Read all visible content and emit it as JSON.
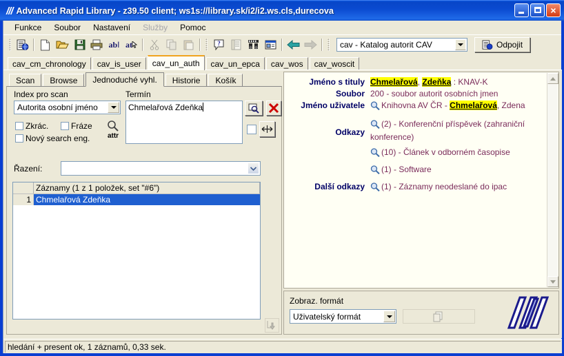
{
  "window": {
    "title": "Advanced Rapid Library - z39.50 client; ws1s://library.sk/i2/i2.ws.cls,durecova",
    "logo_mark": "///",
    "minimize_label": "Minimize",
    "maximize_label": "Maximize",
    "close_label": "×"
  },
  "menu": {
    "items": [
      {
        "label": "Funkce",
        "disabled": false
      },
      {
        "label": "Soubor",
        "disabled": false
      },
      {
        "label": "Nastavení",
        "disabled": false
      },
      {
        "label": "Služby",
        "disabled": true
      },
      {
        "label": "Pomoc",
        "disabled": false
      }
    ]
  },
  "toolbar": {
    "icons": [
      "connect-icon",
      "new-document-icon",
      "open-folder-icon",
      "save-icon",
      "print-icon",
      "abl-icon",
      "at-icon",
      "cut-icon",
      "copy-icon",
      "paste-icon",
      "help-icon",
      "list-icon",
      "find-binoculars-icon",
      "window-icon",
      "back-arrow-icon",
      "forward-arrow-icon"
    ],
    "database_combo": "cav - Katalog autorit CAV",
    "disconnect_label": "Odpojit",
    "disconnect_icon": "connect-icon"
  },
  "main_tabs": [
    {
      "label": "cav_cm_chronology",
      "active": false
    },
    {
      "label": "cav_is_user",
      "active": false
    },
    {
      "label": "cav_un_auth",
      "active": true
    },
    {
      "label": "cav_un_epca",
      "active": false
    },
    {
      "label": "cav_wos",
      "active": false
    },
    {
      "label": "cav_woscit",
      "active": false
    }
  ],
  "sub_tabs": [
    {
      "label": "Scan",
      "active": false
    },
    {
      "label": "Browse",
      "active": false
    },
    {
      "label": "Jednoduché vyhl.",
      "active": true
    },
    {
      "label": "Historie",
      "active": false
    },
    {
      "label": "Košík",
      "active": false
    }
  ],
  "search": {
    "index_label": "Index pro scan",
    "index_value": "Autorita osobní jméno",
    "term_label": "Termín",
    "term_value": "Chmelařová Zdeňka",
    "checkbox_zkrac": "Zkrác.",
    "checkbox_fraze": "Fráze",
    "checkbox_novy": "Nový search eng.",
    "attr_label": "attr",
    "sort_label": "Řazení:",
    "sort_value": "",
    "search_button_icon": "search-magnifier-icon",
    "clear_button_icon": "red-x-icon",
    "expand_button_icon": "horizontal-resize-icon"
  },
  "results": {
    "header_num": "",
    "header_title": "Záznamy (1 z 1 položek, set \"#6\")",
    "rows": [
      {
        "num": "1",
        "title": "Chmelařová Zdeňka"
      }
    ]
  },
  "detail": {
    "rows": [
      {
        "label": "Jméno s tituly",
        "parts": [
          {
            "text": "Chmelařová",
            "highlight": true
          },
          {
            "text": ", ",
            "highlight": false
          },
          {
            "text": "Zdeňka",
            "highlight": true
          },
          {
            "text": " : KNAV-K",
            "highlight": false
          }
        ],
        "icon": ""
      },
      {
        "label": "Soubor",
        "parts": [
          {
            "text": "200 - soubor autorit osobních jmen",
            "highlight": false
          }
        ],
        "icon": ""
      },
      {
        "label": "Jméno uživatele",
        "parts": [
          {
            "text": "Knihovna AV ČR - ",
            "highlight": false
          },
          {
            "text": "Chmelařová",
            "highlight": true
          },
          {
            "text": ", Zdena",
            "highlight": false
          }
        ],
        "icon": "magnifier-icon"
      },
      {
        "label": "Odkazy",
        "parts": [
          {
            "text": "(2) - Konferenční příspěvek (zahraniční konference)",
            "highlight": false
          }
        ],
        "icon": "magnifier-icon"
      },
      {
        "label": "",
        "parts": [
          {
            "text": "(10) - Článek v odborném časopise",
            "highlight": false
          }
        ],
        "icon": "magnifier-icon"
      },
      {
        "label": "",
        "parts": [
          {
            "text": "(1) - Software",
            "highlight": false
          }
        ],
        "icon": "magnifier-icon"
      },
      {
        "label": "Další odkazy",
        "parts": [
          {
            "text": "(1) - Záznamy neodeslané do ipac",
            "highlight": false
          }
        ],
        "icon": "magnifier-icon"
      }
    ]
  },
  "format": {
    "label": "Zobraz. formát",
    "value": "Uživatelský formát",
    "copy_icon": "copy-pages-icon",
    "logo_icon": "slashes-logo"
  },
  "status": {
    "text": "hledání + present ok, 1 záznamů, 0,33 sek."
  },
  "colors": {
    "titlebar_blue": "#0a4ad0",
    "detail_label": "#000066",
    "detail_value": "#7a2b5a",
    "highlight_yellow": "#ffff00",
    "selection_blue": "#1f5fd0",
    "active_tab_orange": "#f0a31e",
    "face": "#ece9d8"
  }
}
